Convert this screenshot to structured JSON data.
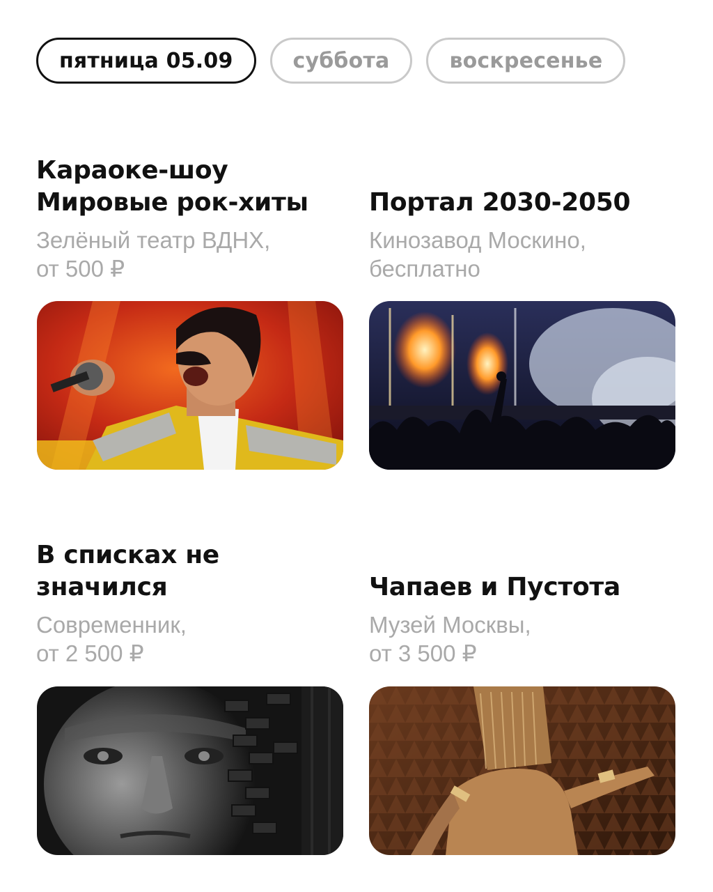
{
  "tabs": [
    {
      "label": "пятница 05.09",
      "active": true
    },
    {
      "label": "суббота",
      "active": false
    },
    {
      "label": "воскресенье",
      "active": false
    }
  ],
  "events": [
    {
      "title_lines": [
        "Караоке-шоу",
        "Мировые рок-хиты"
      ],
      "venue": "Зелёный театр ВДНХ,",
      "price": "от 500 ₽",
      "image": "karaoke-singer-photo"
    },
    {
      "title_lines": [
        "Портал 2030-2050"
      ],
      "venue": "Кинозавод Москино,",
      "price": "бесплатно",
      "image": "concert-crowd-photo"
    },
    {
      "title_lines": [
        "В списках не",
        "значился"
      ],
      "venue": "Современник,",
      "price": "от 2 500 ₽",
      "image": "actor-portrait-photo"
    },
    {
      "title_lines": [
        "Чапаев и Пустота"
      ],
      "venue": "Музей Москвы,",
      "price": "от 3 500 ₽",
      "image": "performer-photo"
    }
  ],
  "colors": {
    "active_border": "#111111",
    "inactive": "#c9c9c9",
    "muted_text": "#a9a9a9"
  }
}
